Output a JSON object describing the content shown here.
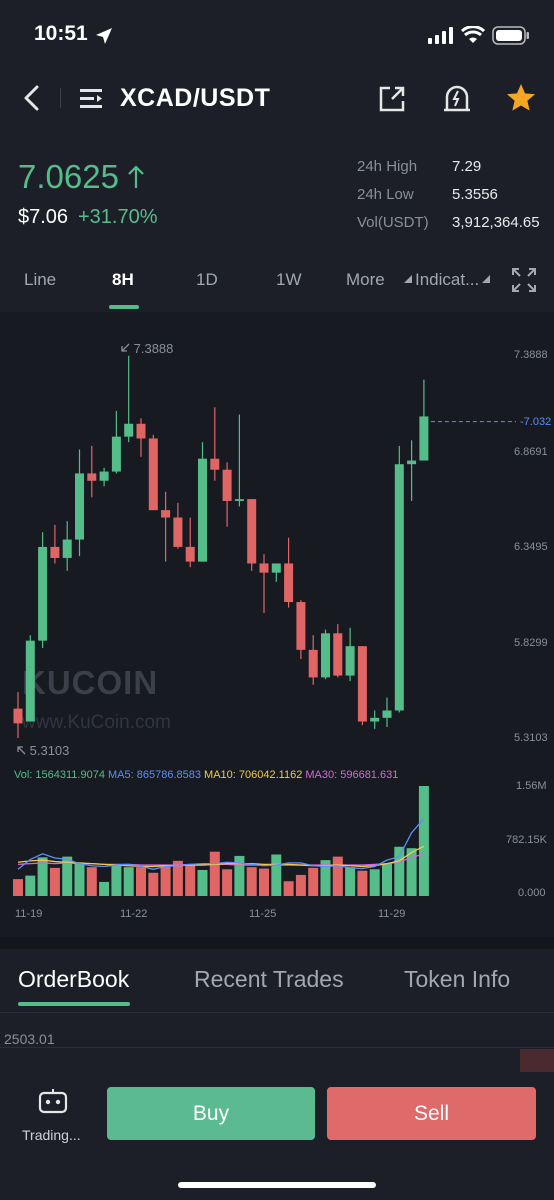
{
  "status_bar": {
    "time": "10:51"
  },
  "header": {
    "pair": "XCAD/USDT"
  },
  "ticker": {
    "last_price": "7.0625",
    "usd_price": "$7.06",
    "change": "+31.70%",
    "high_label": "24h High",
    "high_value": "7.29",
    "low_label": "24h Low",
    "low_value": "5.3556",
    "vol_label": "Vol(USDT)",
    "vol_value": "3,912,364.65"
  },
  "tabs": {
    "line": "Line",
    "h8": "8H",
    "d1": "1D",
    "w1": "1W",
    "more": "More",
    "indicators": "Indicat..."
  },
  "chart": {
    "price_ticks": [
      "7.3888",
      "6.8691",
      "6.3495",
      "5.8299",
      "5.3103"
    ],
    "current_price_tag": "7.032",
    "max_label": "7.3888",
    "min_label": "5.3103",
    "vol_ma_legend": {
      "vol": "Vol: 1564311.9074",
      "ma5": "MA5: 865786.8583",
      "ma10": "MA10: 706042.1162",
      "ma30": "MA30: 596681.631"
    },
    "vol_ticks": [
      "1.56M",
      "782.15K",
      "0.000"
    ],
    "dates": [
      "11-19",
      "11-22",
      "11-25",
      "11-29"
    ],
    "watermark_logo": "KUCOIN",
    "watermark_url": "www.KuCoin.com"
  },
  "colors": {
    "up": "#55bd8a",
    "down": "#e06666",
    "ma5": "#5b8ff9",
    "ma10": "#f2c94c",
    "ma30": "#d16bd8"
  },
  "chart_data": {
    "type": "candlestick",
    "interval": "8H",
    "ylim": [
      5.3103,
      7.3888
    ],
    "volume_ylim": [
      0,
      1564311.9074
    ],
    "candles": [
      {
        "o": 5.47,
        "h": 5.56,
        "l": 5.31,
        "c": 5.39
      },
      {
        "o": 5.4,
        "h": 5.87,
        "l": 5.4,
        "c": 5.84
      },
      {
        "o": 5.84,
        "h": 6.43,
        "l": 5.8,
        "c": 6.35
      },
      {
        "o": 6.35,
        "h": 6.47,
        "l": 6.26,
        "c": 6.29
      },
      {
        "o": 6.29,
        "h": 6.49,
        "l": 6.22,
        "c": 6.39
      },
      {
        "o": 6.39,
        "h": 6.88,
        "l": 6.3,
        "c": 6.75
      },
      {
        "o": 6.75,
        "h": 6.9,
        "l": 6.62,
        "c": 6.71
      },
      {
        "o": 6.71,
        "h": 6.78,
        "l": 6.68,
        "c": 6.76
      },
      {
        "o": 6.76,
        "h": 7.09,
        "l": 6.75,
        "c": 6.95
      },
      {
        "o": 6.95,
        "h": 7.39,
        "l": 6.92,
        "c": 7.02
      },
      {
        "o": 7.02,
        "h": 7.05,
        "l": 6.84,
        "c": 6.94
      },
      {
        "o": 6.94,
        "h": 6.96,
        "l": 6.55,
        "c": 6.55
      },
      {
        "o": 6.55,
        "h": 6.65,
        "l": 6.27,
        "c": 6.51
      },
      {
        "o": 6.51,
        "h": 6.59,
        "l": 6.34,
        "c": 6.35
      },
      {
        "o": 6.35,
        "h": 6.51,
        "l": 6.24,
        "c": 6.27
      },
      {
        "o": 6.27,
        "h": 6.92,
        "l": 6.27,
        "c": 6.83
      },
      {
        "o": 6.83,
        "h": 7.11,
        "l": 6.71,
        "c": 6.77
      },
      {
        "o": 6.77,
        "h": 6.81,
        "l": 6.46,
        "c": 6.6
      },
      {
        "o": 6.6,
        "h": 7.07,
        "l": 6.57,
        "c": 6.61
      },
      {
        "o": 6.61,
        "h": 6.61,
        "l": 6.22,
        "c": 6.26
      },
      {
        "o": 6.26,
        "h": 6.31,
        "l": 5.99,
        "c": 6.21
      },
      {
        "o": 6.21,
        "h": 6.23,
        "l": 6.16,
        "c": 6.26
      },
      {
        "o": 6.26,
        "h": 6.4,
        "l": 6.02,
        "c": 6.05
      },
      {
        "o": 6.05,
        "h": 6.06,
        "l": 5.74,
        "c": 5.79
      },
      {
        "o": 5.79,
        "h": 5.87,
        "l": 5.6,
        "c": 5.64
      },
      {
        "o": 5.64,
        "h": 5.9,
        "l": 5.63,
        "c": 5.88
      },
      {
        "o": 5.88,
        "h": 5.93,
        "l": 5.64,
        "c": 5.65
      },
      {
        "o": 5.65,
        "h": 5.91,
        "l": 5.62,
        "c": 5.81
      },
      {
        "o": 5.81,
        "h": 5.81,
        "l": 5.38,
        "c": 5.4
      },
      {
        "o": 5.4,
        "h": 5.46,
        "l": 5.36,
        "c": 5.42
      },
      {
        "o": 5.42,
        "h": 5.53,
        "l": 5.37,
        "c": 5.46
      },
      {
        "o": 5.46,
        "h": 6.9,
        "l": 5.45,
        "c": 6.8
      },
      {
        "o": 6.8,
        "h": 6.93,
        "l": 6.6,
        "c": 6.82
      },
      {
        "o": 6.82,
        "h": 7.26,
        "l": 6.82,
        "c": 7.06
      }
    ],
    "volumes": [
      240000,
      290000,
      550000,
      400000,
      560000,
      470000,
      410000,
      200000,
      450000,
      410000,
      410000,
      330000,
      420000,
      500000,
      440000,
      370000,
      630000,
      380000,
      570000,
      410000,
      390000,
      590000,
      210000,
      300000,
      400000,
      510000,
      560000,
      410000,
      360000,
      380000,
      460000,
      700000,
      680000,
      1564311
    ],
    "ma5": [
      380000,
      520000,
      600000,
      540000,
      520000,
      460000,
      430000,
      420000,
      440000,
      450000,
      420000,
      380000,
      420000,
      430000,
      450000,
      460000,
      460000,
      480000,
      470000,
      450000,
      430000,
      440000,
      470000,
      470000,
      430000,
      420000,
      430000,
      400000,
      390000,
      420000,
      510000,
      560000,
      900000,
      1100000
    ],
    "ma10": [
      480000,
      500000,
      510000,
      490000,
      480000,
      470000,
      460000,
      450000,
      440000,
      430000,
      420000,
      420000,
      430000,
      430000,
      440000,
      440000,
      450000,
      460000,
      460000,
      460000,
      450000,
      450000,
      450000,
      440000,
      430000,
      430000,
      440000,
      430000,
      420000,
      430000,
      460000,
      500000,
      620000,
      706042
    ],
    "ma30": [
      450000,
      460000,
      470000,
      460000,
      470000,
      460000,
      460000,
      450000,
      450000,
      450000,
      440000,
      440000,
      440000,
      440000,
      450000,
      450000,
      450000,
      450000,
      440000,
      440000,
      440000,
      440000,
      440000,
      440000,
      440000,
      440000,
      440000,
      440000,
      440000,
      450000,
      460000,
      480000,
      550000,
      596681
    ],
    "date_labels": [
      "11-19",
      "11-22",
      "11-25",
      "11-29"
    ],
    "current_price": 7.032
  },
  "bottom_tabs": {
    "orderbook": "OrderBook",
    "recent": "Recent Trades",
    "token": "Token Info"
  },
  "orderbook": {
    "first_row": "2503.01"
  },
  "footer": {
    "trading": "Trading...",
    "buy": "Buy",
    "sell": "Sell"
  }
}
